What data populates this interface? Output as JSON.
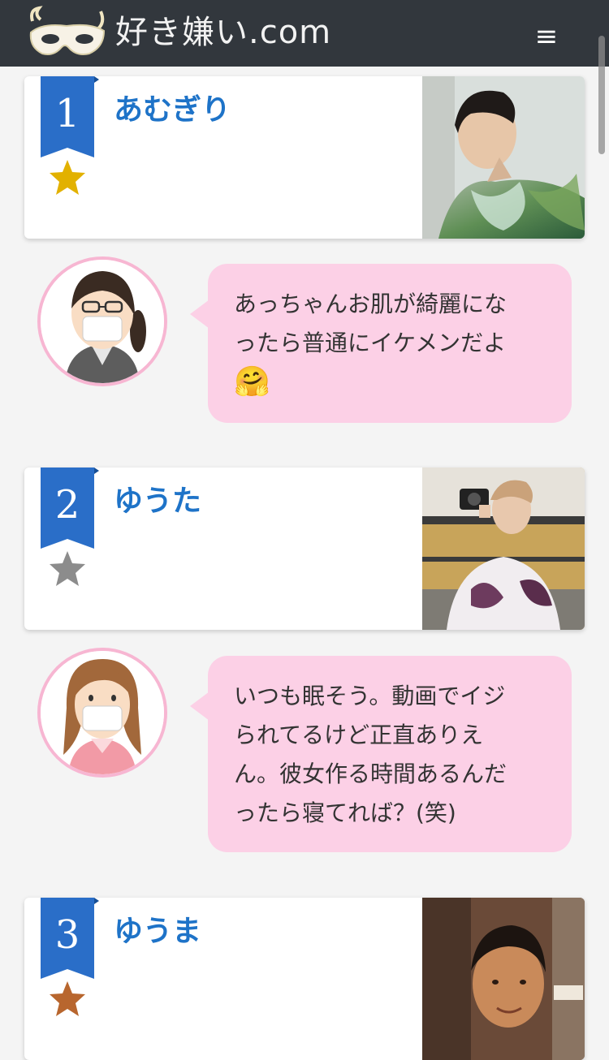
{
  "header": {
    "site_title": "好き嫌い.com",
    "logo_icon": "mask-icon",
    "menu_icon": "hamburger-icon",
    "menu_glyph": "≡",
    "background_color": "#32373d"
  },
  "rankings": [
    {
      "rank": "1",
      "name": "あむぎり",
      "star_color": "#e2b100",
      "star_icon": "gold-star-icon",
      "comment_lines": [
        "あっちゃんお肌が綺麗にな",
        "ったら普通にイケメンだよ"
      ],
      "comment_emoji": "🤗",
      "commenter_avatar": "avatar-glasses-mask"
    },
    {
      "rank": "2",
      "name": "ゆうた",
      "star_color": "#8c8c8c",
      "star_icon": "silver-star-icon",
      "comment_lines": [
        "いつも眠そう。動画でイジ",
        "られてるけど正直ありえ",
        "ん。彼女作る時間あるんだ",
        "ったら寝てれば？(笑)"
      ],
      "commenter_avatar": "avatar-long-hair-mask"
    },
    {
      "rank": "3",
      "name": "ゆうま",
      "star_color": "#b8662e",
      "star_icon": "bronze-star-icon"
    }
  ],
  "colors": {
    "ribbon": "#2a6ec8",
    "name_text": "#1e73c8",
    "bubble_bg": "#fcd0e6",
    "avatar_border": "#f7b6d2"
  }
}
